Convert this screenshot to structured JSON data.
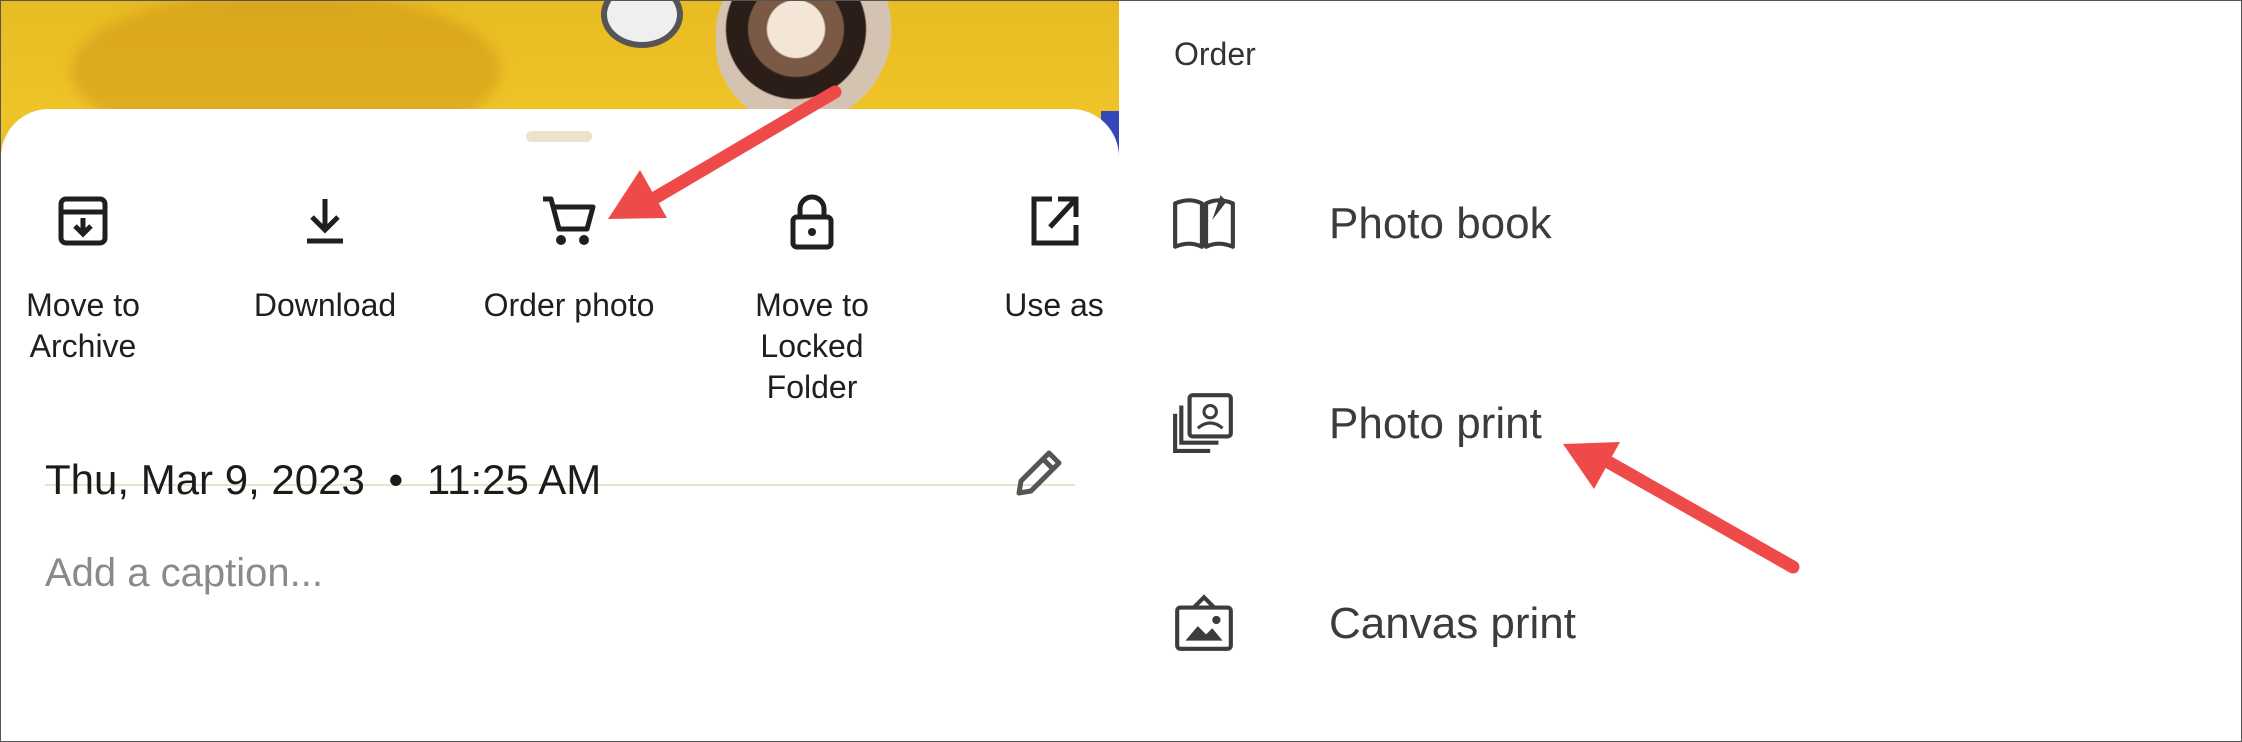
{
  "sheet": {
    "actions": [
      {
        "id": "archive",
        "label": "Move to\nArchive",
        "icon": "archive-icon"
      },
      {
        "id": "download",
        "label": "Download",
        "icon": "download-icon"
      },
      {
        "id": "order",
        "label": "Order photo",
        "icon": "cart-icon"
      },
      {
        "id": "locked",
        "label": "Move to\nLocked\nFolder",
        "icon": "lock-icon"
      },
      {
        "id": "useas",
        "label": "Use as",
        "icon": "open-external-icon"
      }
    ],
    "date": "Thu, Mar 9, 2023",
    "separator": "•",
    "time": "11:25 AM",
    "caption_placeholder": "Add a caption..."
  },
  "order_menu": {
    "title": "Order",
    "items": [
      {
        "label": "Photo book",
        "icon": "book-icon"
      },
      {
        "label": "Photo print",
        "icon": "photo-print-icon"
      },
      {
        "label": "Canvas print",
        "icon": "canvas-print-icon"
      }
    ]
  },
  "colors": {
    "annotation_arrow": "#ef4a4a",
    "icon": "#1f1f1f",
    "divider": "#ebe3c9",
    "photo_yellow": "#efc428"
  }
}
